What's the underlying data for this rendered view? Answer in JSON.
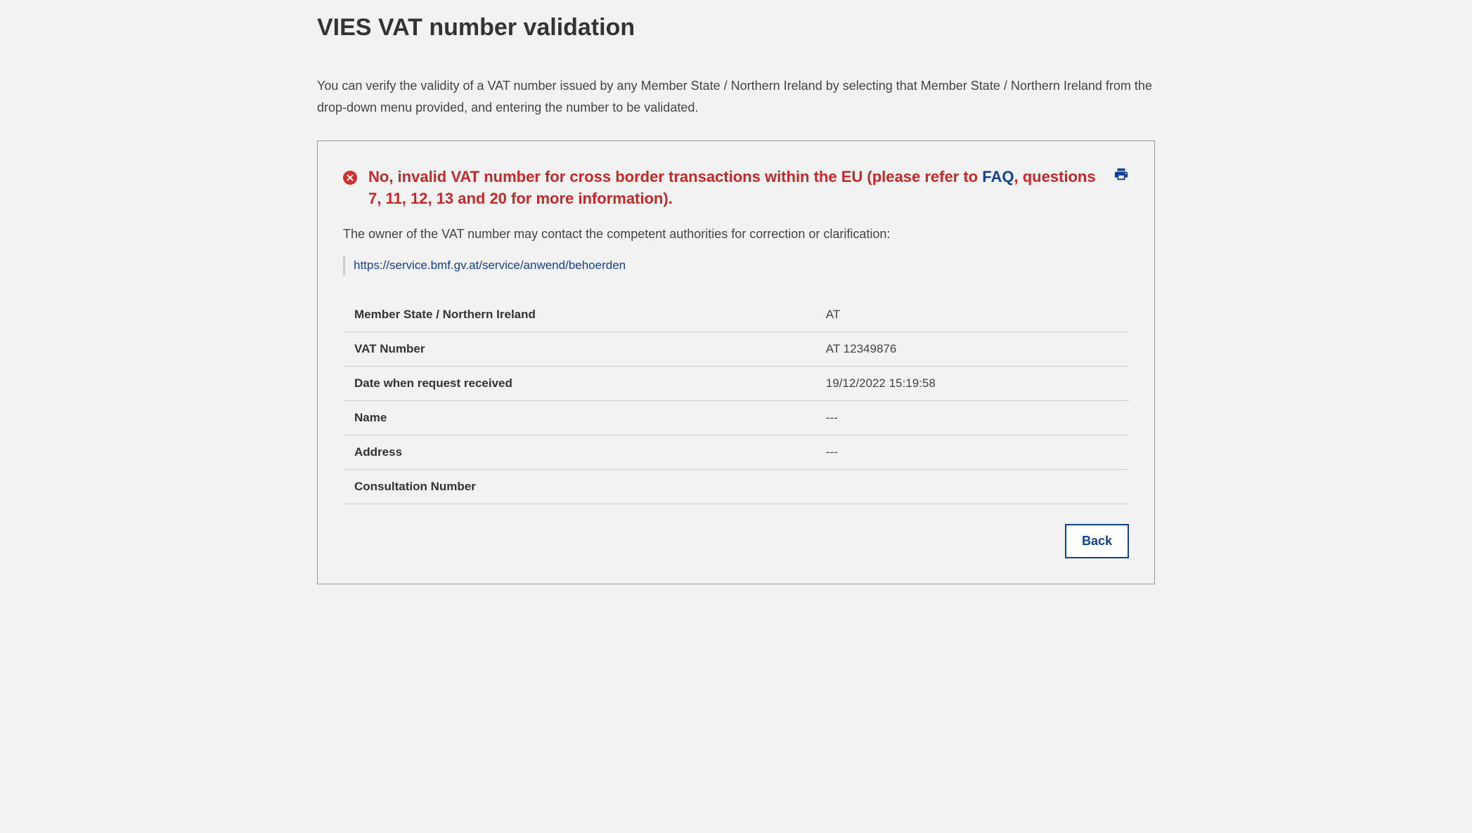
{
  "page": {
    "title": "VIES VAT number validation",
    "intro": "You can verify the validity of a VAT number issued by any Member State / Northern Ireland by selecting that Member State / Northern Ireland from the drop-down menu provided, and entering the number to be validated."
  },
  "result": {
    "error_prefix": "No, invalid VAT number for cross border transactions within the EU (please refer to ",
    "faq_link_text": "FAQ",
    "error_suffix": ", questions 7, 11, 12, 13 and 20 for more information).",
    "owner_text": "The owner of the VAT number may contact the competent authorities for correction or clarification:",
    "authority_link": "https://service.bmf.gv.at/service/anwend/behoerden"
  },
  "details": {
    "rows": [
      {
        "label": "Member State / Northern Ireland",
        "value": "AT"
      },
      {
        "label": "VAT Number",
        "value": "AT 12349876"
      },
      {
        "label": "Date when request received",
        "value": "19/12/2022 15:19:58"
      },
      {
        "label": "Name",
        "value": "---"
      },
      {
        "label": "Address",
        "value": "---"
      },
      {
        "label": "Consultation Number",
        "value": ""
      }
    ]
  },
  "actions": {
    "back_label": "Back"
  }
}
